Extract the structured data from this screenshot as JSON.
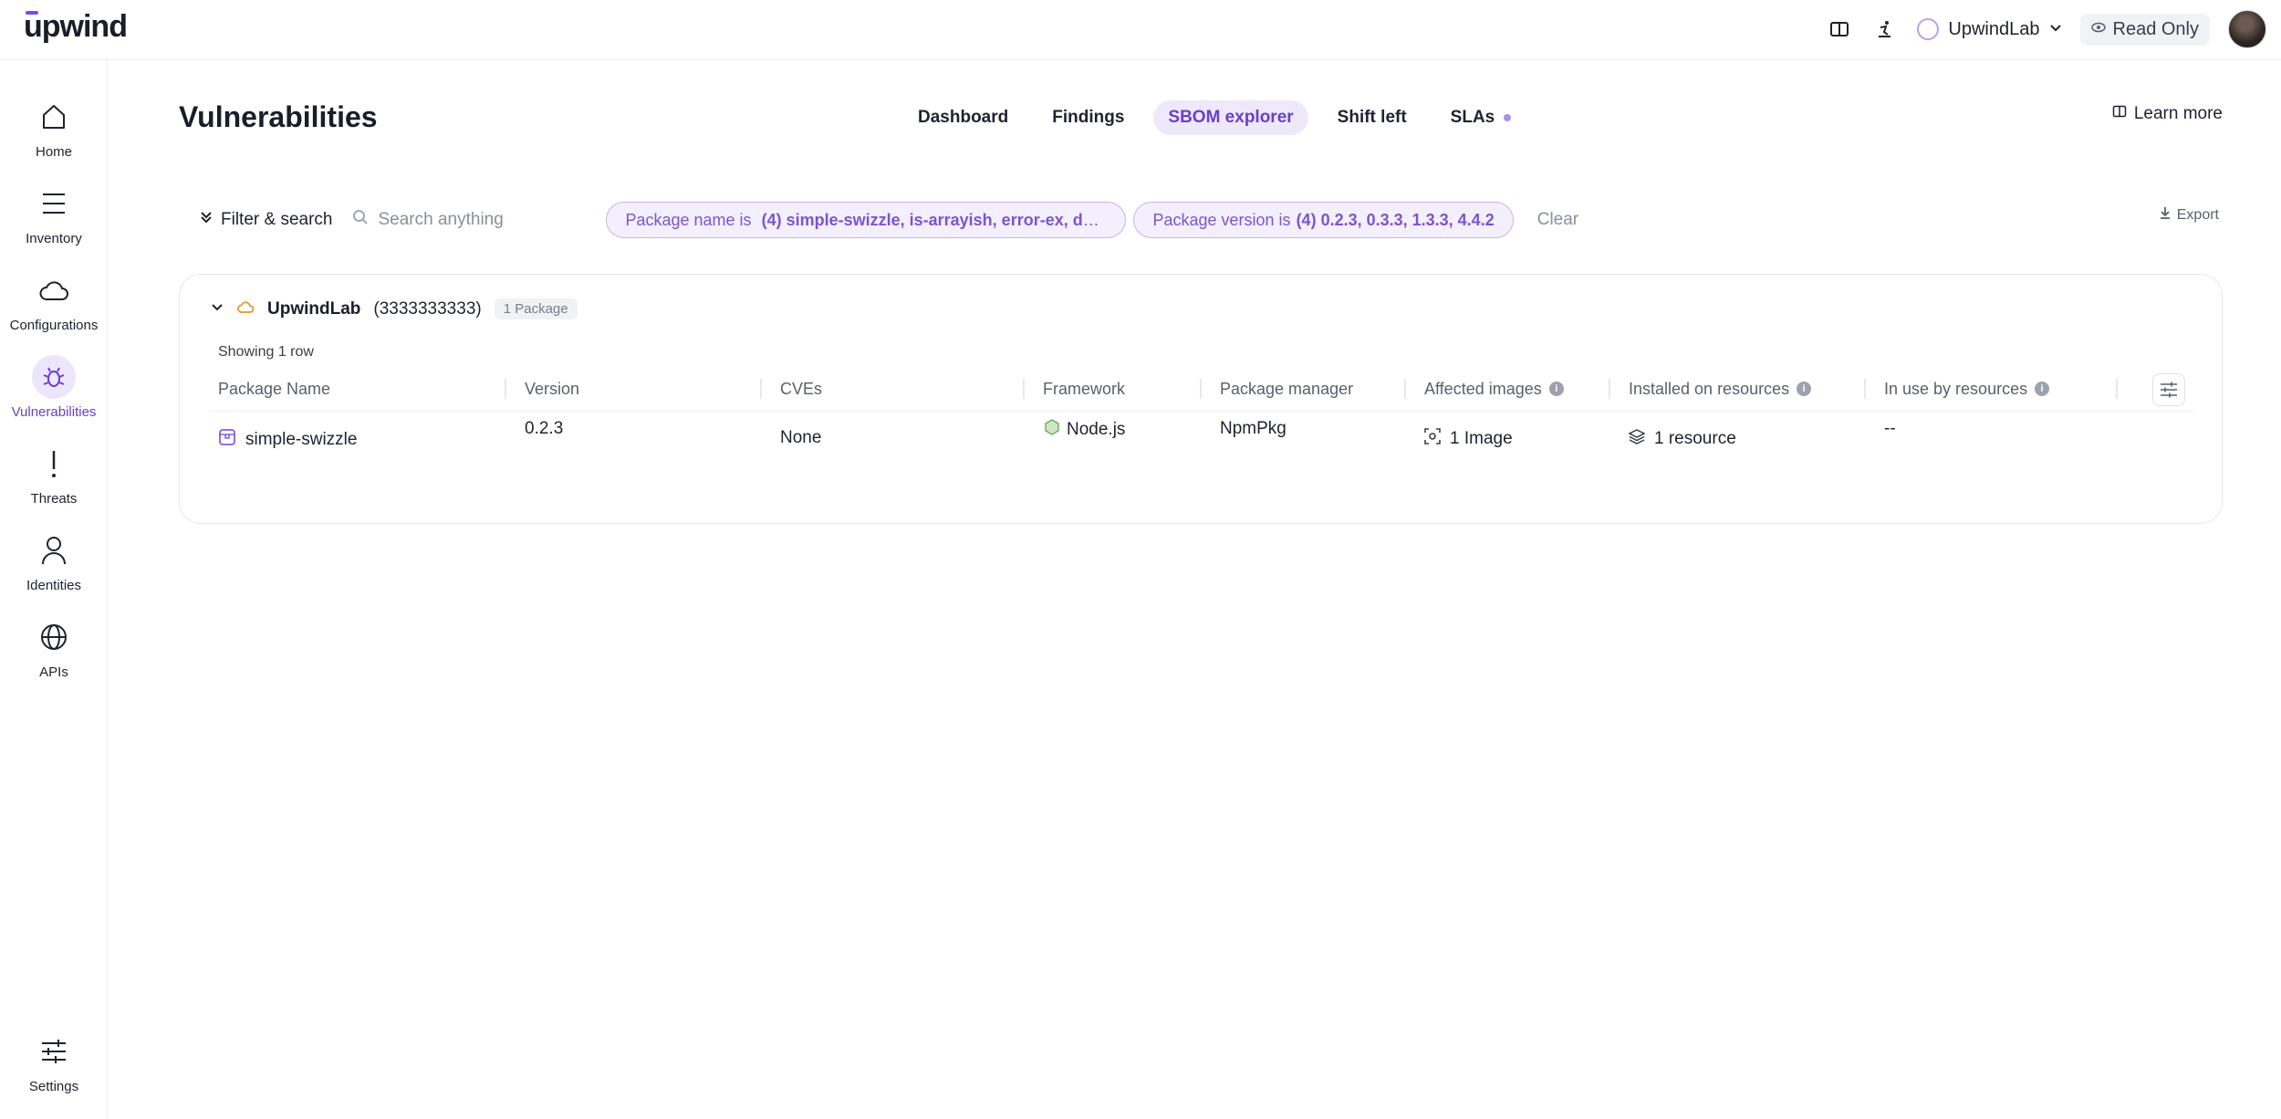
{
  "app": {
    "logo": "upwind"
  },
  "topbar": {
    "tenant": "UpwindLab",
    "read_only": "Read Only"
  },
  "sidebar": {
    "items": [
      {
        "label": "Home",
        "icon": "home-icon"
      },
      {
        "label": "Inventory",
        "icon": "list-icon"
      },
      {
        "label": "Configurations",
        "icon": "cloud-icon"
      },
      {
        "label": "Vulnerabilities",
        "icon": "bug-icon",
        "active": true
      },
      {
        "label": "Threats",
        "icon": "exclamation-icon"
      },
      {
        "label": "Identities",
        "icon": "person-icon"
      },
      {
        "label": "APIs",
        "icon": "globe-icon"
      }
    ],
    "settings": {
      "label": "Settings",
      "icon": "sliders-icon"
    }
  },
  "page": {
    "title": "Vulnerabilities",
    "tabs": [
      {
        "label": "Dashboard"
      },
      {
        "label": "Findings"
      },
      {
        "label": "SBOM explorer",
        "active": true
      },
      {
        "label": "Shift left"
      },
      {
        "label": "SLAs"
      }
    ],
    "learn_more": "Learn more"
  },
  "filters": {
    "filter_label": "Filter & search",
    "search_placeholder": "Search anything",
    "chips": [
      {
        "prefix": "Package name is",
        "value": "(4) simple-swizzle, is-arrayish, error-ex, deb..."
      },
      {
        "prefix": "Package version is",
        "value": "(4) 0.2.3, 0.3.3, 1.3.3, 4.4.2"
      }
    ],
    "clear": "Clear",
    "export": "Export"
  },
  "group": {
    "name": "UpwindLab",
    "id": "(3333333333)",
    "badge": "1 Package",
    "showing": "Showing 1 row"
  },
  "table": {
    "columns": [
      "Package Name",
      "Version",
      "CVEs",
      "Framework",
      "Package manager",
      "Affected images",
      "Installed on resources",
      "In use by resources"
    ],
    "rows": [
      {
        "package_name": "simple-swizzle",
        "version": "0.2.3",
        "cves": "None",
        "framework": "Node.js",
        "package_manager": "NpmPkg",
        "affected_images": "1 Image",
        "installed_on": "1 resource",
        "in_use_by": "--"
      }
    ]
  },
  "colors": {
    "accent": "#6a3fc9",
    "accent_bg": "#eee8fb",
    "chip_border": "#c6b4ee"
  }
}
